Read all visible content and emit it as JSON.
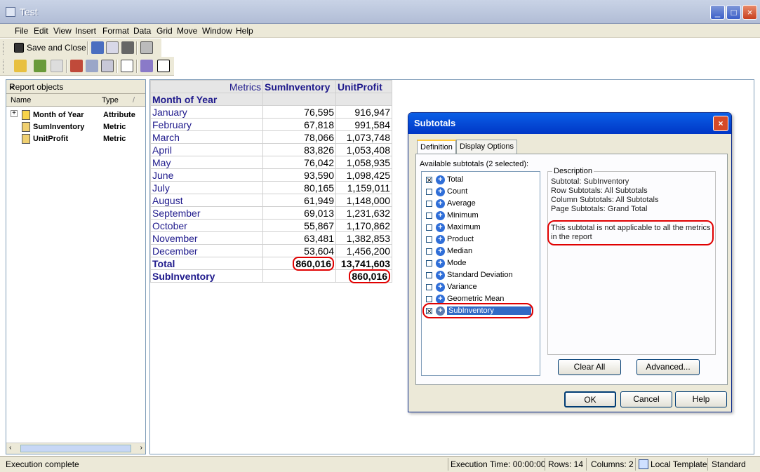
{
  "window": {
    "title": "Test"
  },
  "menu": [
    "File",
    "Edit",
    "View",
    "Insert",
    "Format",
    "Data",
    "Grid",
    "Move",
    "Window",
    "Help"
  ],
  "toolbar": {
    "save_close": "Save and Close"
  },
  "report_objects": {
    "title": "Report objects",
    "col_name": "Name",
    "col_type": "Type",
    "items": [
      {
        "name": "Month of Year",
        "type": "Attribute"
      },
      {
        "name": "SumInventory",
        "type": "Metric"
      },
      {
        "name": "UnitProfit",
        "type": "Metric"
      }
    ]
  },
  "grid": {
    "metrics_label": "Metrics",
    "col1": "SumInventory",
    "col2": "UnitProfit",
    "row_header": "Month of Year",
    "rows": [
      {
        "month": "January",
        "sum": "76,595",
        "profit": "916,947"
      },
      {
        "month": "February",
        "sum": "67,818",
        "profit": "991,584"
      },
      {
        "month": "March",
        "sum": "78,066",
        "profit": "1,073,748"
      },
      {
        "month": "April",
        "sum": "83,826",
        "profit": "1,053,408"
      },
      {
        "month": "May",
        "sum": "76,042",
        "profit": "1,058,935"
      },
      {
        "month": "June",
        "sum": "93,590",
        "profit": "1,098,425"
      },
      {
        "month": "July",
        "sum": "80,165",
        "profit": "1,159,011"
      },
      {
        "month": "August",
        "sum": "61,949",
        "profit": "1,148,000"
      },
      {
        "month": "September",
        "sum": "69,013",
        "profit": "1,231,632"
      },
      {
        "month": "October",
        "sum": "55,867",
        "profit": "1,170,862"
      },
      {
        "month": "November",
        "sum": "63,481",
        "profit": "1,382,853"
      },
      {
        "month": "December",
        "sum": "53,604",
        "profit": "1,456,200"
      }
    ],
    "total_label": "Total",
    "total_sum": "860,016",
    "total_profit": "13,741,603",
    "sub_label": "SubInventory",
    "sub_profit": "860,016"
  },
  "dialog": {
    "title": "Subtotals",
    "tab_definition": "Definition",
    "tab_display": "Display Options",
    "available_label": "Available subtotals (2 selected):",
    "subtotals": [
      {
        "label": "Total",
        "checked": true
      },
      {
        "label": "Count",
        "checked": false
      },
      {
        "label": "Average",
        "checked": false
      },
      {
        "label": "Minimum",
        "checked": false
      },
      {
        "label": "Maximum",
        "checked": false
      },
      {
        "label": "Product",
        "checked": false
      },
      {
        "label": "Median",
        "checked": false
      },
      {
        "label": "Mode",
        "checked": false
      },
      {
        "label": "Standard Deviation",
        "checked": false
      },
      {
        "label": "Variance",
        "checked": false
      },
      {
        "label": "Geometric Mean",
        "checked": false
      },
      {
        "label": "SubInventory",
        "checked": true
      }
    ],
    "description_legend": "Description",
    "desc_lines": [
      "Subtotal: SubInventory",
      "Row Subtotals: All Subtotals",
      "Column Subtotals: All Subtotals",
      "Page Subtotals: Grand Total"
    ],
    "warning_line1": "This subtotal is not applicable to all the metrics",
    "warning_line2": "in the report",
    "clear_all": "Clear All",
    "advanced": "Advanced...",
    "ok": "OK",
    "cancel": "Cancel",
    "help": "Help"
  },
  "status": {
    "left": "Execution complete",
    "exec_time": "Execution Time: 00:00:00",
    "rows": "Rows: 14",
    "columns": "Columns: 2",
    "template": "Local Template",
    "mode": "Standard"
  }
}
